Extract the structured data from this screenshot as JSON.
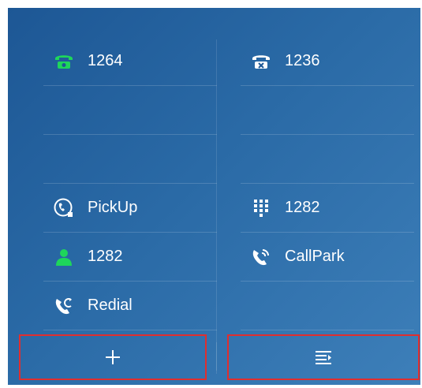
{
  "colors": {
    "accent_green": "#1ed65b",
    "icon_white": "#ffffff",
    "highlight_border": "#e02e2e"
  },
  "left_keys": [
    {
      "label": "1264",
      "icon": "phone-green-icon"
    },
    {
      "label": "",
      "icon": ""
    },
    {
      "label": "",
      "icon": ""
    },
    {
      "label": "PickUp",
      "icon": "pickup-phone-icon"
    },
    {
      "label": "1282",
      "icon": "contact-green-icon"
    },
    {
      "label": "Redial",
      "icon": "redial-icon"
    }
  ],
  "right_keys": [
    {
      "label": "1236",
      "icon": "phone-off-icon"
    },
    {
      "label": "",
      "icon": ""
    },
    {
      "label": "",
      "icon": ""
    },
    {
      "label": "1282",
      "icon": "dialpad-icon"
    },
    {
      "label": "CallPark",
      "icon": "callpark-icon"
    },
    {
      "label": "",
      "icon": ""
    }
  ],
  "bottom": {
    "add_label": "+",
    "menu_icon": "menu-icon"
  }
}
